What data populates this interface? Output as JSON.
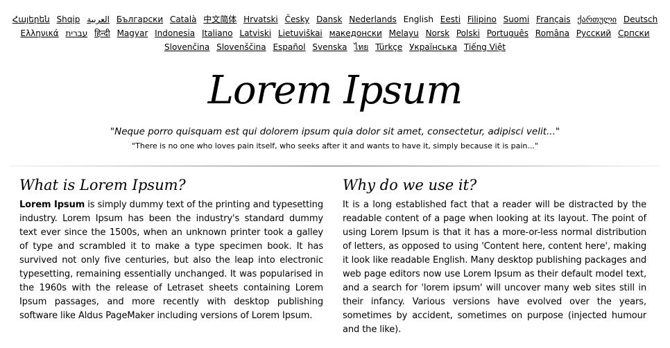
{
  "languages": [
    {
      "label": "Հայերեն",
      "current": false
    },
    {
      "label": "Shqip",
      "current": false
    },
    {
      "label": "العربية",
      "current": false
    },
    {
      "label": "Български",
      "current": false
    },
    {
      "label": "Català",
      "current": false
    },
    {
      "label": "中文简体",
      "current": false
    },
    {
      "label": "Hrvatski",
      "current": false
    },
    {
      "label": "Česky",
      "current": false
    },
    {
      "label": "Dansk",
      "current": false
    },
    {
      "label": "Nederlands",
      "current": false
    },
    {
      "label": "English",
      "current": true
    },
    {
      "label": "Eesti",
      "current": false
    },
    {
      "label": "Filipino",
      "current": false
    },
    {
      "label": "Suomi",
      "current": false
    },
    {
      "label": "Français",
      "current": false
    },
    {
      "label": "ქართული",
      "current": false
    },
    {
      "label": "Deutsch",
      "current": false
    },
    {
      "label": "Ελληνικά",
      "current": false
    },
    {
      "label": "עברית",
      "current": false
    },
    {
      "label": "हिन्दी",
      "current": false
    },
    {
      "label": "Magyar",
      "current": false
    },
    {
      "label": "Indonesia",
      "current": false
    },
    {
      "label": "Italiano",
      "current": false
    },
    {
      "label": "Latviski",
      "current": false
    },
    {
      "label": "Lietuviškai",
      "current": false
    },
    {
      "label": "македонски",
      "current": false
    },
    {
      "label": "Melayu",
      "current": false
    },
    {
      "label": "Norsk",
      "current": false
    },
    {
      "label": "Polski",
      "current": false
    },
    {
      "label": "Português",
      "current": false
    },
    {
      "label": "Româna",
      "current": false
    },
    {
      "label": "Pyccкий",
      "current": false
    },
    {
      "label": "Српски",
      "current": false
    },
    {
      "label": "Slovenčina",
      "current": false
    },
    {
      "label": "Slovenščina",
      "current": false
    },
    {
      "label": "Español",
      "current": false
    },
    {
      "label": "Svenska",
      "current": false
    },
    {
      "label": "ไทย",
      "current": false
    },
    {
      "label": "Türkçe",
      "current": false
    },
    {
      "label": "Українська",
      "current": false
    },
    {
      "label": "Tiếng Việt",
      "current": false
    }
  ],
  "header": {
    "title": "Lorem Ipsum",
    "quote_latin": "\"Neque porro quisquam est qui dolorem ipsum quia dolor sit amet, consectetur, adipisci velit...\"",
    "quote_english": "\"There is no one who loves pain itself, who seeks after it and wants to have it, simply because it is pain...\""
  },
  "sections": {
    "what": {
      "heading": "What is Lorem Ipsum?",
      "lead": "Lorem Ipsum",
      "body": " is simply dummy text of the printing and typesetting industry. Lorem Ipsum has been the industry's standard dummy text ever since the 1500s, when an unknown printer took a galley of type and scrambled it to make a type specimen book. It has survived not only five centuries, but also the leap into electronic typesetting, remaining essentially unchanged. It was popularised in the 1960s with the release of Letraset sheets containing Lorem Ipsum passages, and more recently with desktop publishing software like Aldus PageMaker including versions of Lorem Ipsum."
    },
    "why": {
      "heading": "Why do we use it?",
      "body": "It is a long established fact that a reader will be distracted by the readable content of a page when looking at its layout. The point of using Lorem Ipsum is that it has a more-or-less normal distribution of letters, as opposed to using 'Content here, content here', making it look like readable English. Many desktop publishing packages and web page editors now use Lorem Ipsum as their default model text, and a search for 'lorem ipsum' will uncover many web sites still in their infancy. Various versions have evolved over the years, sometimes by accident, sometimes on purpose (injected humour and the like)."
    }
  }
}
